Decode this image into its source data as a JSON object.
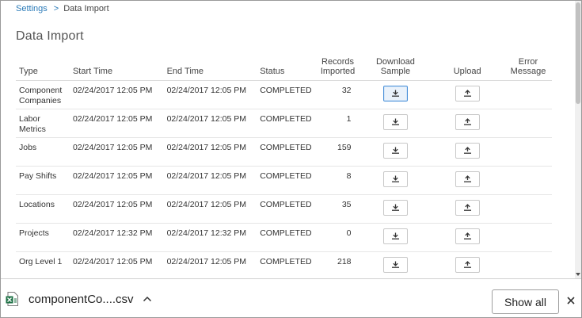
{
  "breadcrumb": {
    "parent": "Settings",
    "separator": ">",
    "current": "Data Import"
  },
  "page_title": "Data Import",
  "table": {
    "headers": {
      "type": "Type",
      "start": "Start Time",
      "end": "End Time",
      "status": "Status",
      "records_line1": "Records",
      "records_line2": "Imported",
      "download_line1": "Download",
      "download_line2": "Sample",
      "upload": "Upload",
      "error_line1": "Error",
      "error_line2": "Message"
    },
    "rows": [
      {
        "type_l1": "Component",
        "type_l2": "Companies",
        "start": "02/24/2017 12:05 PM",
        "end": "02/24/2017 12:05 PM",
        "status": "COMPLETED",
        "records": "32",
        "error": ""
      },
      {
        "type_l1": "Labor",
        "type_l2": "Metrics",
        "start": "02/24/2017 12:05 PM",
        "end": "02/24/2017 12:05 PM",
        "status": "COMPLETED",
        "records": "1",
        "error": ""
      },
      {
        "type_l1": "Jobs",
        "type_l2": "",
        "start": "02/24/2017 12:05 PM",
        "end": "02/24/2017 12:05 PM",
        "status": "COMPLETED",
        "records": "159",
        "error": ""
      },
      {
        "type_l1": "Pay Shifts",
        "type_l2": "",
        "start": "02/24/2017 12:05 PM",
        "end": "02/24/2017 12:05 PM",
        "status": "COMPLETED",
        "records": "8",
        "error": ""
      },
      {
        "type_l1": "Locations",
        "type_l2": "",
        "start": "02/24/2017 12:05 PM",
        "end": "02/24/2017 12:05 PM",
        "status": "COMPLETED",
        "records": "35",
        "error": ""
      },
      {
        "type_l1": "Projects",
        "type_l2": "",
        "start": "02/24/2017 12:32 PM",
        "end": "02/24/2017 12:32 PM",
        "status": "COMPLETED",
        "records": "0",
        "error": ""
      },
      {
        "type_l1": "Org Level 1",
        "type_l2": "",
        "start": "02/24/2017 12:05 PM",
        "end": "02/24/2017 12:05 PM",
        "status": "COMPLETED",
        "records": "218",
        "error": ""
      }
    ]
  },
  "download_bar": {
    "file_name": "componentCo....csv",
    "file_icon": "excel-file-icon",
    "show_all_label": "Show all"
  },
  "colors": {
    "link": "#2a7ab8",
    "active_button_border": "#4a90d9"
  }
}
